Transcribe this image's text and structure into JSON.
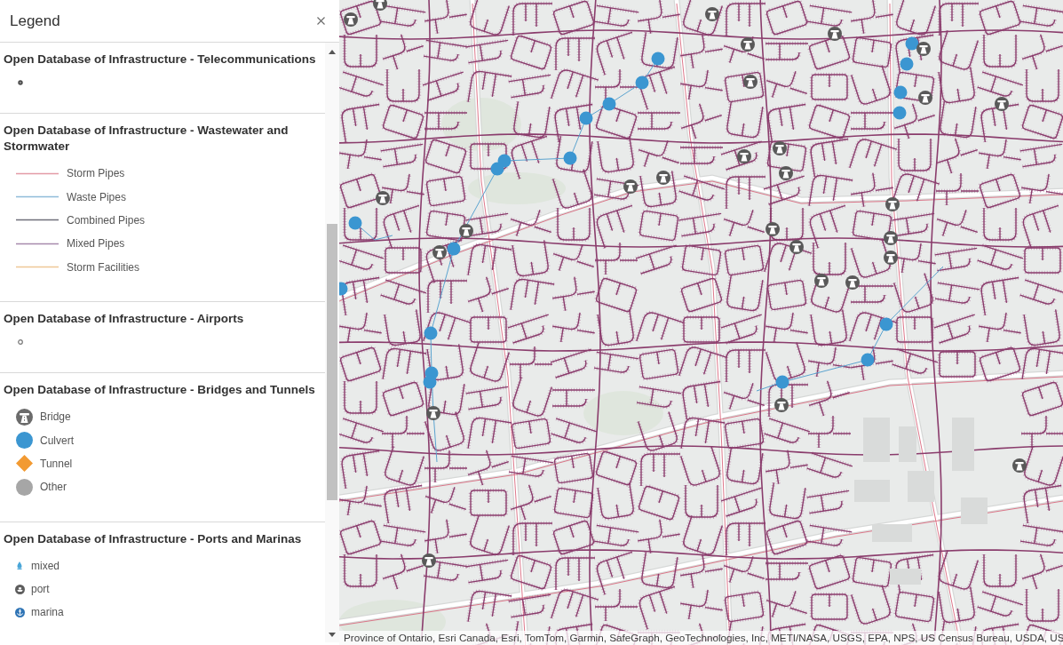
{
  "panel": {
    "title": "Legend"
  },
  "layers": [
    {
      "title": "Open Database of Infrastructure - Telecommunications",
      "items": [
        {
          "kind": "dot"
        }
      ]
    },
    {
      "title": "Open Database of Infrastructure - Wastewater and Stormwater",
      "items": [
        {
          "kind": "line",
          "label": "Storm Pipes",
          "color": "#e39aa6"
        },
        {
          "kind": "line",
          "label": "Waste Pipes",
          "color": "#8ebbd9"
        },
        {
          "kind": "line",
          "label": "Combined Pipes",
          "color": "#6f6f7a"
        },
        {
          "kind": "line",
          "label": "Mixed Pipes",
          "color": "#a78aad"
        },
        {
          "kind": "line",
          "label": "Storm Facilities",
          "color": "#efc896"
        }
      ]
    },
    {
      "title": "Open Database of Infrastructure - Airports",
      "items": [
        {
          "kind": "ring"
        }
      ]
    },
    {
      "title": "Open Database of Infrastructure - Bridges and Tunnels",
      "items": [
        {
          "kind": "bridge",
          "label": "Bridge"
        },
        {
          "kind": "circle",
          "label": "Culvert",
          "color": "#3b96d1"
        },
        {
          "kind": "diamond",
          "label": "Tunnel",
          "color": "#f29a32"
        },
        {
          "kind": "circle",
          "label": "Other",
          "color": "#a6a6a6"
        }
      ]
    },
    {
      "title": "Open Database of Infrastructure - Ports and Marinas",
      "items": [
        {
          "kind": "drop",
          "label": "mixed"
        },
        {
          "kind": "port",
          "label": "port"
        },
        {
          "kind": "anchor",
          "label": "marina"
        }
      ]
    }
  ],
  "map": {
    "attribution": "Province of Ontario, Esri Canada, Esri, TomTom, Garmin, SafeGraph, GeoTechnologies, Inc, METI/NASA, USGS, EPA, NPS, US Census Bureau, USDA, US"
  }
}
